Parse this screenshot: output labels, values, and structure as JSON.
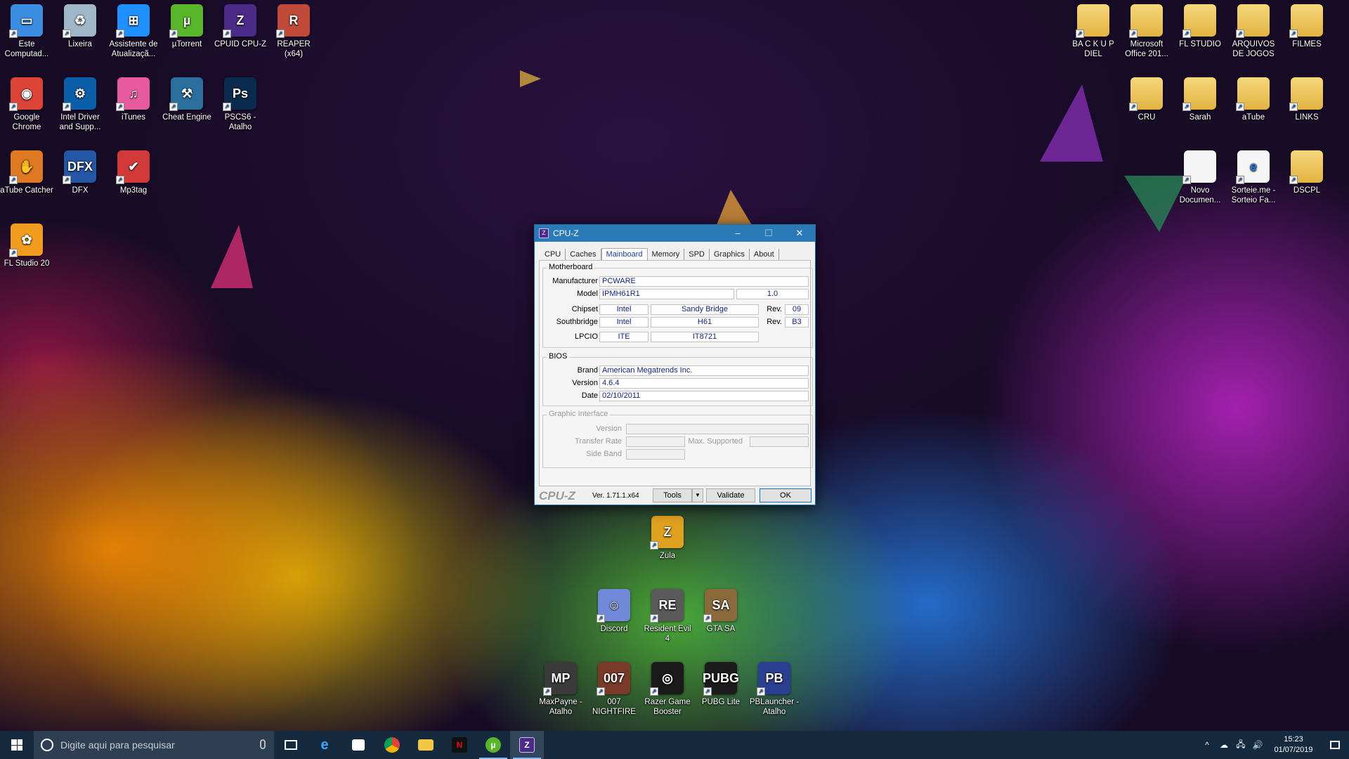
{
  "desktop_left_icons": [
    {
      "label": "Este Computad...",
      "icon": "computer-icon",
      "color": "#3a8de0",
      "glyph": "▭"
    },
    {
      "label": "Lixeira",
      "icon": "recycle-bin-icon",
      "color": "#9fb7c8",
      "glyph": "♻"
    },
    {
      "label": "Assistente de Atualizaçã...",
      "icon": "windows-update-icon",
      "color": "#1e90ff",
      "glyph": "⊞"
    },
    {
      "label": "µTorrent",
      "icon": "utorrent-icon",
      "color": "#59b52a",
      "glyph": "µ"
    },
    {
      "label": "CPUID CPU-Z",
      "icon": "cpuz-icon",
      "color": "#4b2a88",
      "glyph": "Z"
    },
    {
      "label": "REAPER (x64)",
      "icon": "reaper-icon",
      "color": "#c04a3a",
      "glyph": "R"
    },
    {
      "label": "Google Chrome",
      "icon": "chrome-icon",
      "color": "#db4437",
      "glyph": "◉"
    },
    {
      "label": "Intel Driver and Supp...",
      "icon": "intel-driver-icon",
      "color": "#0a5fa8",
      "glyph": "⚙"
    },
    {
      "label": "iTunes",
      "icon": "itunes-icon",
      "color": "#e85aa0",
      "glyph": "♫"
    },
    {
      "label": "Cheat Engine",
      "icon": "cheat-engine-icon",
      "color": "#2b6f9e",
      "glyph": "⚒"
    },
    {
      "label": "PSCS6 - Atalho",
      "icon": "photoshop-icon",
      "color": "#0b2b4e",
      "glyph": "Ps"
    },
    {
      "label": "aTube Catcher",
      "icon": "atube-catcher-icon",
      "color": "#e07a22",
      "glyph": "✋"
    },
    {
      "label": "DFX",
      "icon": "dfx-icon",
      "color": "#2456a6",
      "glyph": "DFX"
    },
    {
      "label": "Mp3tag",
      "icon": "mp3tag-icon",
      "color": "#d23a3a",
      "glyph": "✔"
    },
    {
      "label": "FL Studio 20",
      "icon": "fl-studio-icon",
      "color": "#f19b1f",
      "glyph": "✿"
    }
  ],
  "desktop_right_icons": [
    {
      "label": "BA C K U P DIEL",
      "icon": "folder-icon"
    },
    {
      "label": "Microsoft Office 201...",
      "icon": "folder-icon"
    },
    {
      "label": "FL STUDIO",
      "icon": "folder-icon"
    },
    {
      "label": "ARQUIVOS DE JOGOS",
      "icon": "folder-icon"
    },
    {
      "label": "FILMES",
      "icon": "folder-icon"
    },
    {
      "label": "CRU",
      "icon": "folder-icon"
    },
    {
      "label": "Sarah",
      "icon": "folder-icon"
    },
    {
      "label": "aTube",
      "icon": "folder-icon"
    },
    {
      "label": "LINKS",
      "icon": "folder-icon"
    },
    {
      "label": "Novo Documen...",
      "icon": "text-document-icon"
    },
    {
      "label": "Sorteie.me - Sorteio Fa...",
      "icon": "edge-shortcut-icon"
    },
    {
      "label": "DSCPL",
      "icon": "folder-icon"
    }
  ],
  "desktop_center_icons": [
    {
      "label": "Zula",
      "icon": "zula-icon",
      "color": "#e0a020",
      "glyph": "Z"
    },
    {
      "label": "Discord",
      "icon": "discord-icon",
      "color": "#7289da",
      "glyph": "☺"
    },
    {
      "label": "Resident Evil 4",
      "icon": "resident-evil-icon",
      "color": "#5a5a5a",
      "glyph": "RE"
    },
    {
      "label": "GTA SA",
      "icon": "gta-sa-icon",
      "color": "#8a6a3a",
      "glyph": "SA"
    },
    {
      "label": "MaxPayne - Atalho",
      "icon": "maxpayne-icon",
      "color": "#3a3a3a",
      "glyph": "MP"
    },
    {
      "label": "007 NIGHTFIRE",
      "icon": "nightfire-icon",
      "color": "#7a3a2a",
      "glyph": "007"
    },
    {
      "label": "Razer Game Booster",
      "icon": "razer-icon",
      "color": "#1a1a1a",
      "glyph": "◎"
    },
    {
      "label": "PUBG Lite",
      "icon": "pubg-icon",
      "color": "#1b1b1b",
      "glyph": "PUBG"
    },
    {
      "label": "PBLauncher - Atalho",
      "icon": "pblauncher-icon",
      "color": "#2a3f8f",
      "glyph": "PB"
    }
  ],
  "cpuz": {
    "title": "CPU-Z",
    "minimize": "–",
    "maximize": "☐",
    "close": "✕",
    "tabs": [
      "CPU",
      "Caches",
      "Mainboard",
      "Memory",
      "SPD",
      "Graphics",
      "About"
    ],
    "active_tab": "Mainboard",
    "motherboard": {
      "group_title": "Motherboard",
      "manufacturer_label": "Manufacturer",
      "manufacturer": "PCWARE",
      "model_label": "Model",
      "model": "IPMH61R1",
      "model_rev": "1.0",
      "chipset_label": "Chipset",
      "chipset_vendor": "Intel",
      "chipset_name": "Sandy Bridge",
      "rev_label": "Rev.",
      "chipset_rev": "09",
      "southbridge_label": "Southbridge",
      "southbridge_vendor": "Intel",
      "southbridge_name": "H61",
      "southbridge_rev": "B3",
      "lpcio_label": "LPCIO",
      "lpcio_vendor": "ITE",
      "lpcio_name": "IT8721"
    },
    "bios": {
      "group_title": "BIOS",
      "brand_label": "Brand",
      "brand": "American Megatrends Inc.",
      "version_label": "Version",
      "version": "4.6.4",
      "date_label": "Date",
      "date": "02/10/2011"
    },
    "graphic_interface": {
      "group_title": "Graphic Interface",
      "version_label": "Version",
      "transfer_rate_label": "Transfer Rate",
      "max_supported_label": "Max. Supported",
      "side_band_label": "Side Band"
    },
    "footer": {
      "brand": "CPU-Z",
      "version": "Ver. 1.71.1.x64",
      "tools_label": "Tools",
      "tools_arrow": "▼",
      "validate_label": "Validate",
      "ok_label": "OK"
    }
  },
  "taskbar": {
    "search_placeholder": "Digite aqui para pesquisar",
    "time": "15:23",
    "date": "01/07/2019",
    "tray_icons": [
      "^",
      "☁",
      "🖧",
      "🔊"
    ]
  }
}
